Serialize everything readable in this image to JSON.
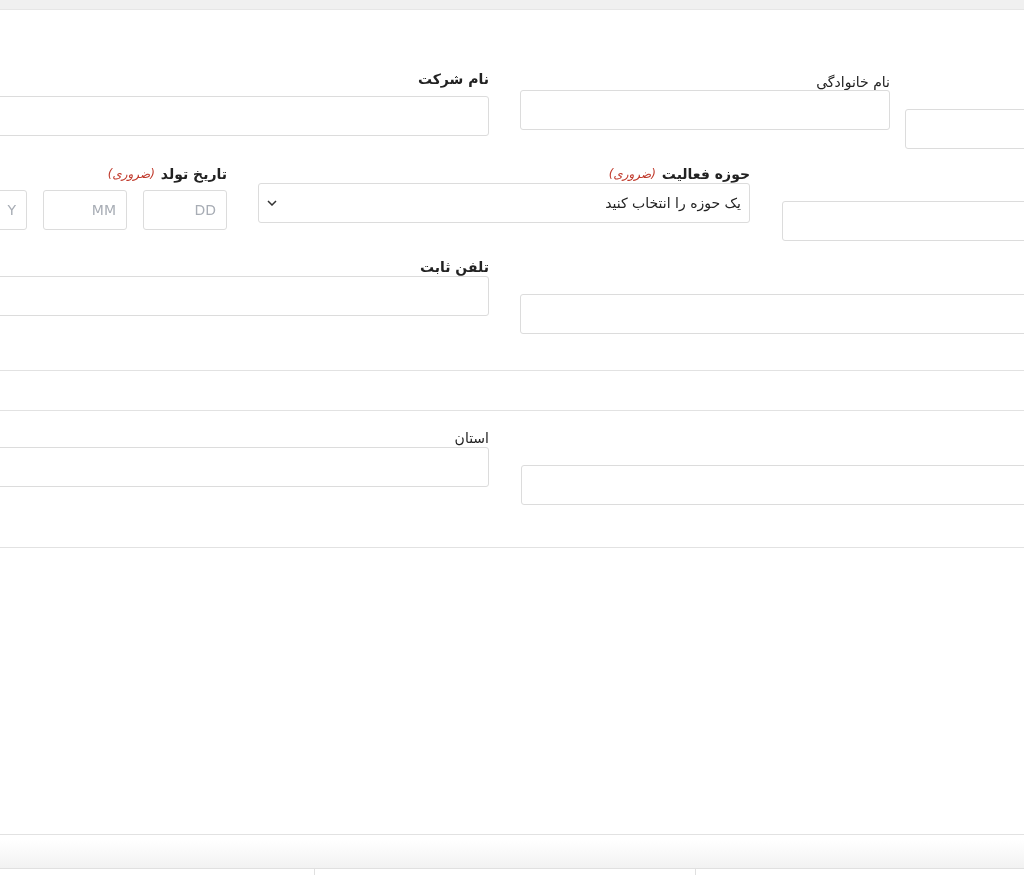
{
  "rows": [
    {
      "fields": [
        {
          "kind": "text"
        },
        {
          "kind": "text",
          "label": {
            "text": "نام خانوادگی",
            "bold": false
          }
        },
        {
          "kind": "text",
          "label": {
            "text": "نام شرکت",
            "bold": true
          }
        }
      ]
    },
    {
      "fields": [
        {
          "kind": "text"
        },
        {
          "kind": "select",
          "label": {
            "text": "حوزه فعالیت",
            "bold": true,
            "required_note": "(ضروری)"
          },
          "value": "یک حوزه را انتخاب کنید"
        },
        {
          "kind": "date",
          "label": {
            "text": "تاریخ تولد",
            "bold": true,
            "required_note": "(ضروری)"
          },
          "parts": [
            {
              "placeholder": "DD"
            },
            {
              "placeholder": "MM"
            },
            {
              "placeholder": "Y"
            }
          ]
        }
      ]
    },
    {
      "fields": [
        {
          "kind": "text"
        },
        {
          "kind": "text",
          "label": {
            "text": "تلفن ثابت",
            "bold": true
          }
        }
      ]
    },
    {
      "fields": [
        {
          "kind": "text"
        },
        {
          "kind": "text",
          "label": {
            "text": "استان",
            "bold": false
          }
        }
      ]
    }
  ]
}
